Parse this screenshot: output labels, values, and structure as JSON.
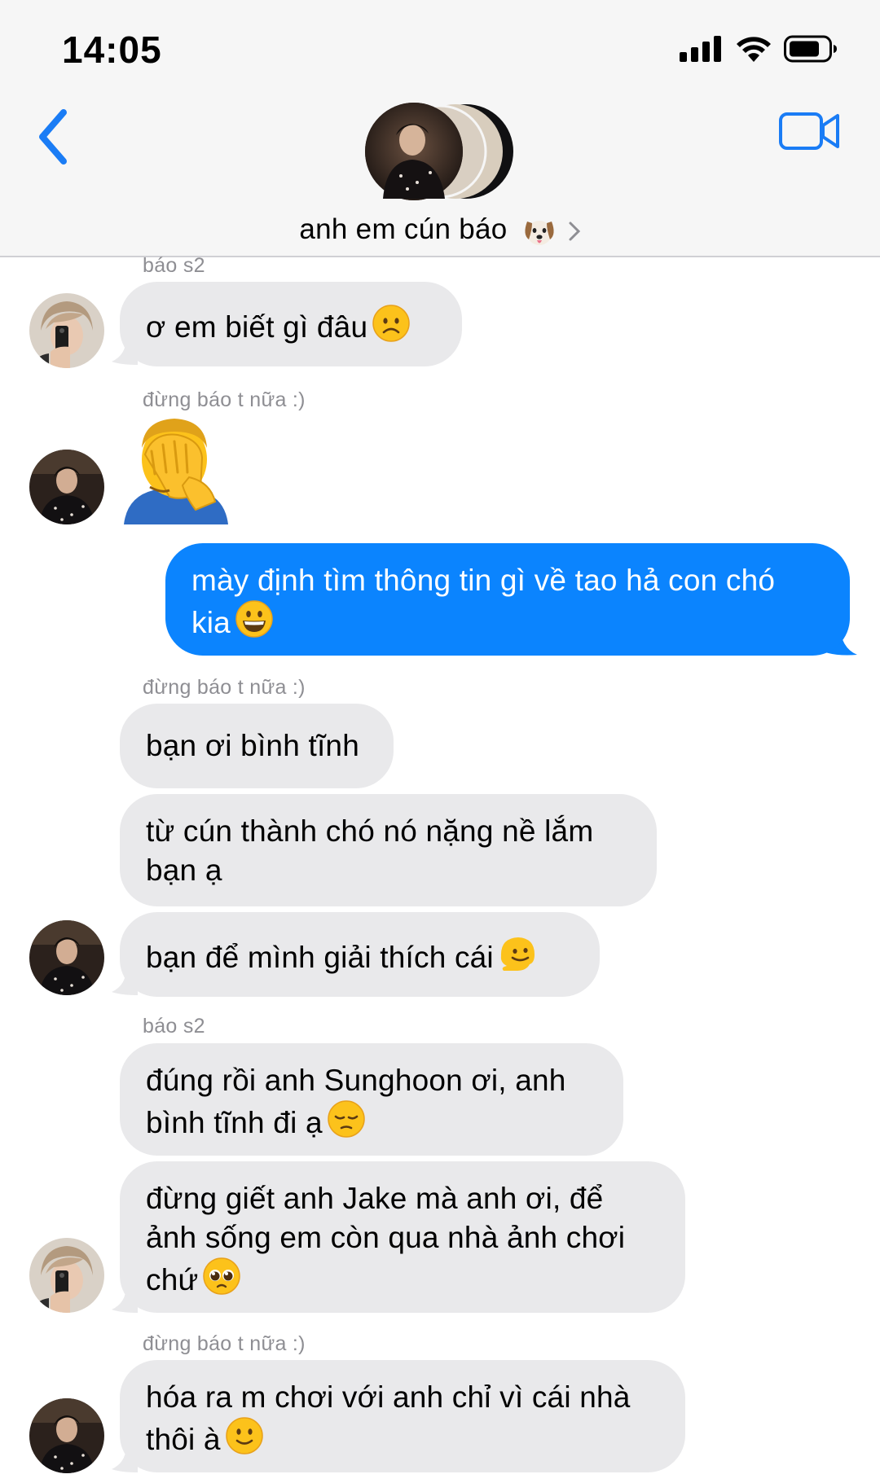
{
  "status_bar": {
    "time": "14:05"
  },
  "header": {
    "chat_name": "anh em cún báo"
  },
  "messages": [
    {
      "sender": "báo s2",
      "text": "ơ em biết gì đâu"
    },
    {
      "sender": "đừng báo t nữa :)"
    },
    {
      "text": "mày định tìm thông tin gì về tao hả con chó",
      "text2": "kia"
    },
    {
      "sender": "đừng báo t nữa :)",
      "text": "bạn ơi bình tĩnh"
    },
    {
      "text": "từ cún thành chó nó nặng nề lắm",
      "text2": "bạn ạ"
    },
    {
      "text": "bạn để mình giải thích cái"
    },
    {
      "sender": "báo s2",
      "text": "đúng rồi anh Sunghoon ơi, anh",
      "text2": "bình tĩnh đi ạ"
    },
    {
      "text": "đừng giết anh Jake mà anh ơi, để",
      "text2": "ảnh sống em còn qua nhà ảnh chơi",
      "text3": "chứ"
    },
    {
      "sender": "đừng báo t nữa :)",
      "text": "hóa ra m chơi với anh chỉ vì cái nhà",
      "text2": "thôi à"
    }
  ],
  "colors": {
    "outgoing_bubble": "#0b84fe",
    "incoming_bubble": "#e9e9eb",
    "accent": "#1a7cf5"
  },
  "icons": [
    "signal-icon",
    "wifi-icon",
    "battery-icon",
    "back-chevron-icon",
    "video-call-icon",
    "dog-emoji-icon",
    "chevron-right-icon",
    "frowning-emoji",
    "facepalm-emoji",
    "grinning-emoji",
    "melting-emoji",
    "pensive-emoji",
    "pleading-emoji",
    "slightly-smiling-emoji"
  ]
}
